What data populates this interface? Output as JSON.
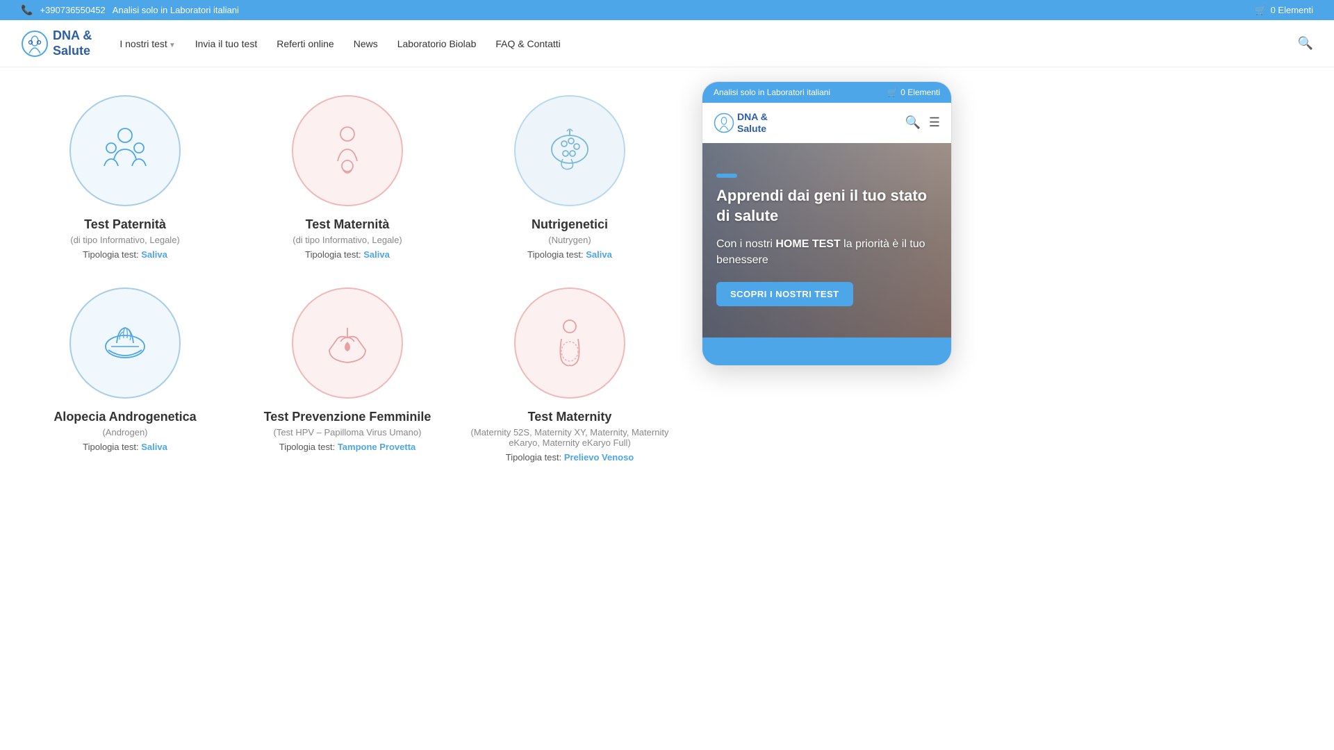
{
  "topbar": {
    "phone": "+390736550452",
    "text": "Analisi solo in Laboratori italiani",
    "cart_label": "0 Elementi"
  },
  "header": {
    "logo_line1": "DNA &",
    "logo_line2": "Salute",
    "nav": [
      {
        "label": "I nostri test",
        "has_arrow": true
      },
      {
        "label": "Invia il tuo test",
        "has_arrow": false
      },
      {
        "label": "Referti online",
        "has_arrow": false
      },
      {
        "label": "News",
        "has_arrow": false
      },
      {
        "label": "Laboratorio Biolab",
        "has_arrow": false
      },
      {
        "label": "FAQ & Contatti",
        "has_arrow": false
      }
    ]
  },
  "products": [
    {
      "title": "Test Paternità",
      "subtitle": "(di tipo Informativo, Legale)",
      "tipologia_label": "Tipologia test:",
      "tipologia_link": "Saliva",
      "icon_style": "blue",
      "icon_type": "family"
    },
    {
      "title": "Test Maternità",
      "subtitle": "(di tipo Informativo, Legale)",
      "tipologia_label": "Tipologia test:",
      "tipologia_link": "Saliva",
      "icon_style": "pink",
      "icon_type": "mother_child"
    },
    {
      "title": "Nutrigenetici",
      "subtitle": "(Nutrygen)",
      "tipologia_label": "Tipologia test:",
      "tipologia_link": "Saliva",
      "icon_style": "lightblue",
      "icon_type": "nutrition"
    },
    {
      "title": "Alopecia Androgenetica",
      "subtitle": "(Androgen)",
      "tipologia_label": "Tipologia test:",
      "tipologia_link": "Saliva",
      "icon_style": "blue",
      "icon_type": "hair"
    },
    {
      "title": "Test Prevenzione Femminile",
      "subtitle": "(Test HPV – Papilloma Virus Umano)",
      "tipologia_label": "Tipologia test:",
      "tipologia_link": "Tampone Provetta",
      "icon_style": "pink",
      "icon_type": "care"
    },
    {
      "title": "Test Maternity",
      "subtitle": "(Maternity 52S, Maternity XY, Maternity, Maternity eKaryo, Maternity eKaryo Full)",
      "tipologia_label": "Tipologia test:",
      "tipologia_link": "Prelievo Venoso",
      "icon_style": "pink",
      "icon_type": "pregnancy"
    }
  ],
  "mobile": {
    "topbar_text": "Analisi solo in Laboratori italiani",
    "cart_label": "0 Elementi",
    "logo_line1": "DNA &",
    "logo_line2": "Salute",
    "hero_title": "Apprendi dai geni il tuo stato di salute",
    "hero_subtitle_normal": "Con i nostri ",
    "hero_subtitle_bold": "HOME TEST",
    "hero_subtitle_rest": " la priorità è il tuo benessere",
    "cta_label": "SCOPRI I NOSTRI TEST"
  }
}
